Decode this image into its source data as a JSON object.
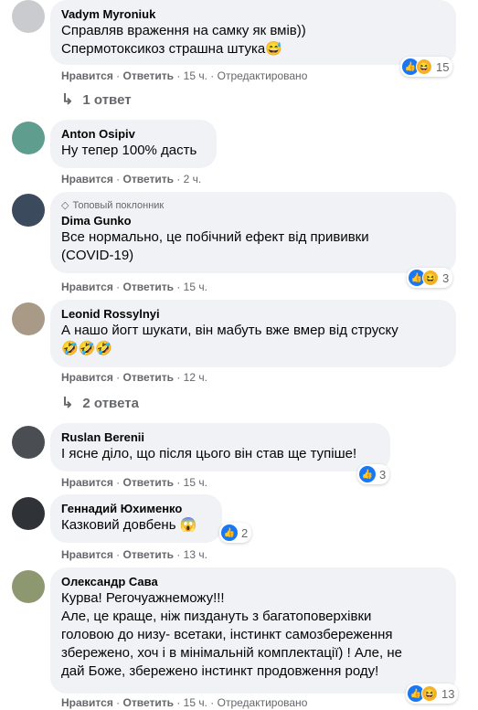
{
  "actions": {
    "like": "Нравится",
    "reply": "Ответить",
    "dot": "·"
  },
  "comments": [
    {
      "author": "Vadym Myroniuk",
      "lines": [
        "Справляв враження на самку як вмів))",
        "Спермотоксикоз страшна штука😅"
      ],
      "time": "15 ч.",
      "edited": "Отредактировано",
      "reactions": "15",
      "replies": "1 ответ"
    },
    {
      "author": "Anton Osipiv",
      "lines": [
        "Ну тепер 100% дасть"
      ],
      "time": "2 ч."
    },
    {
      "author": "Dima Gunko",
      "badge": "Топовый поклонник",
      "lines": [
        "Все нормально, це побічний ефект від прививки",
        "(COVID-19)"
      ],
      "time": "15 ч.",
      "reactions": "3"
    },
    {
      "author": "Leonid Rossylnyi",
      "lines": [
        "А нашо йогт шукати, він мабуть вже вмер від струску",
        "🤣🤣🤣"
      ],
      "time": "12 ч.",
      "replies": "2 ответа"
    },
    {
      "author": "Ruslan Berenii",
      "lines": [
        "І ясне діло, що після цього він став ще тупіше!"
      ],
      "time": "15 ч.",
      "reactions": "3"
    },
    {
      "author": "Геннадий Юхименко",
      "lines": [
        "Казковий довбень 😱"
      ],
      "time": "13 ч.",
      "reactions": "2"
    },
    {
      "author": "Олександр Сава",
      "lines": [
        "Курва! Регочуажнеможу!!!",
        "Але, це краще, ніж пиздануть з багатоповерхівки",
        "головою до низу- всетаки, інстинкт самозбереження",
        "збережено, хоч і в мінімальній комплектації) ! Але, не",
        "дай Боже, збережено інстинкт продовження роду!"
      ],
      "time": "15 ч.",
      "edited": "Отредактировано",
      "reactions": "13"
    }
  ],
  "colors": {
    "bubble": "#f0f2f5",
    "meta": "#65676b",
    "like": "#1877f2",
    "haha": "#f7b125"
  }
}
